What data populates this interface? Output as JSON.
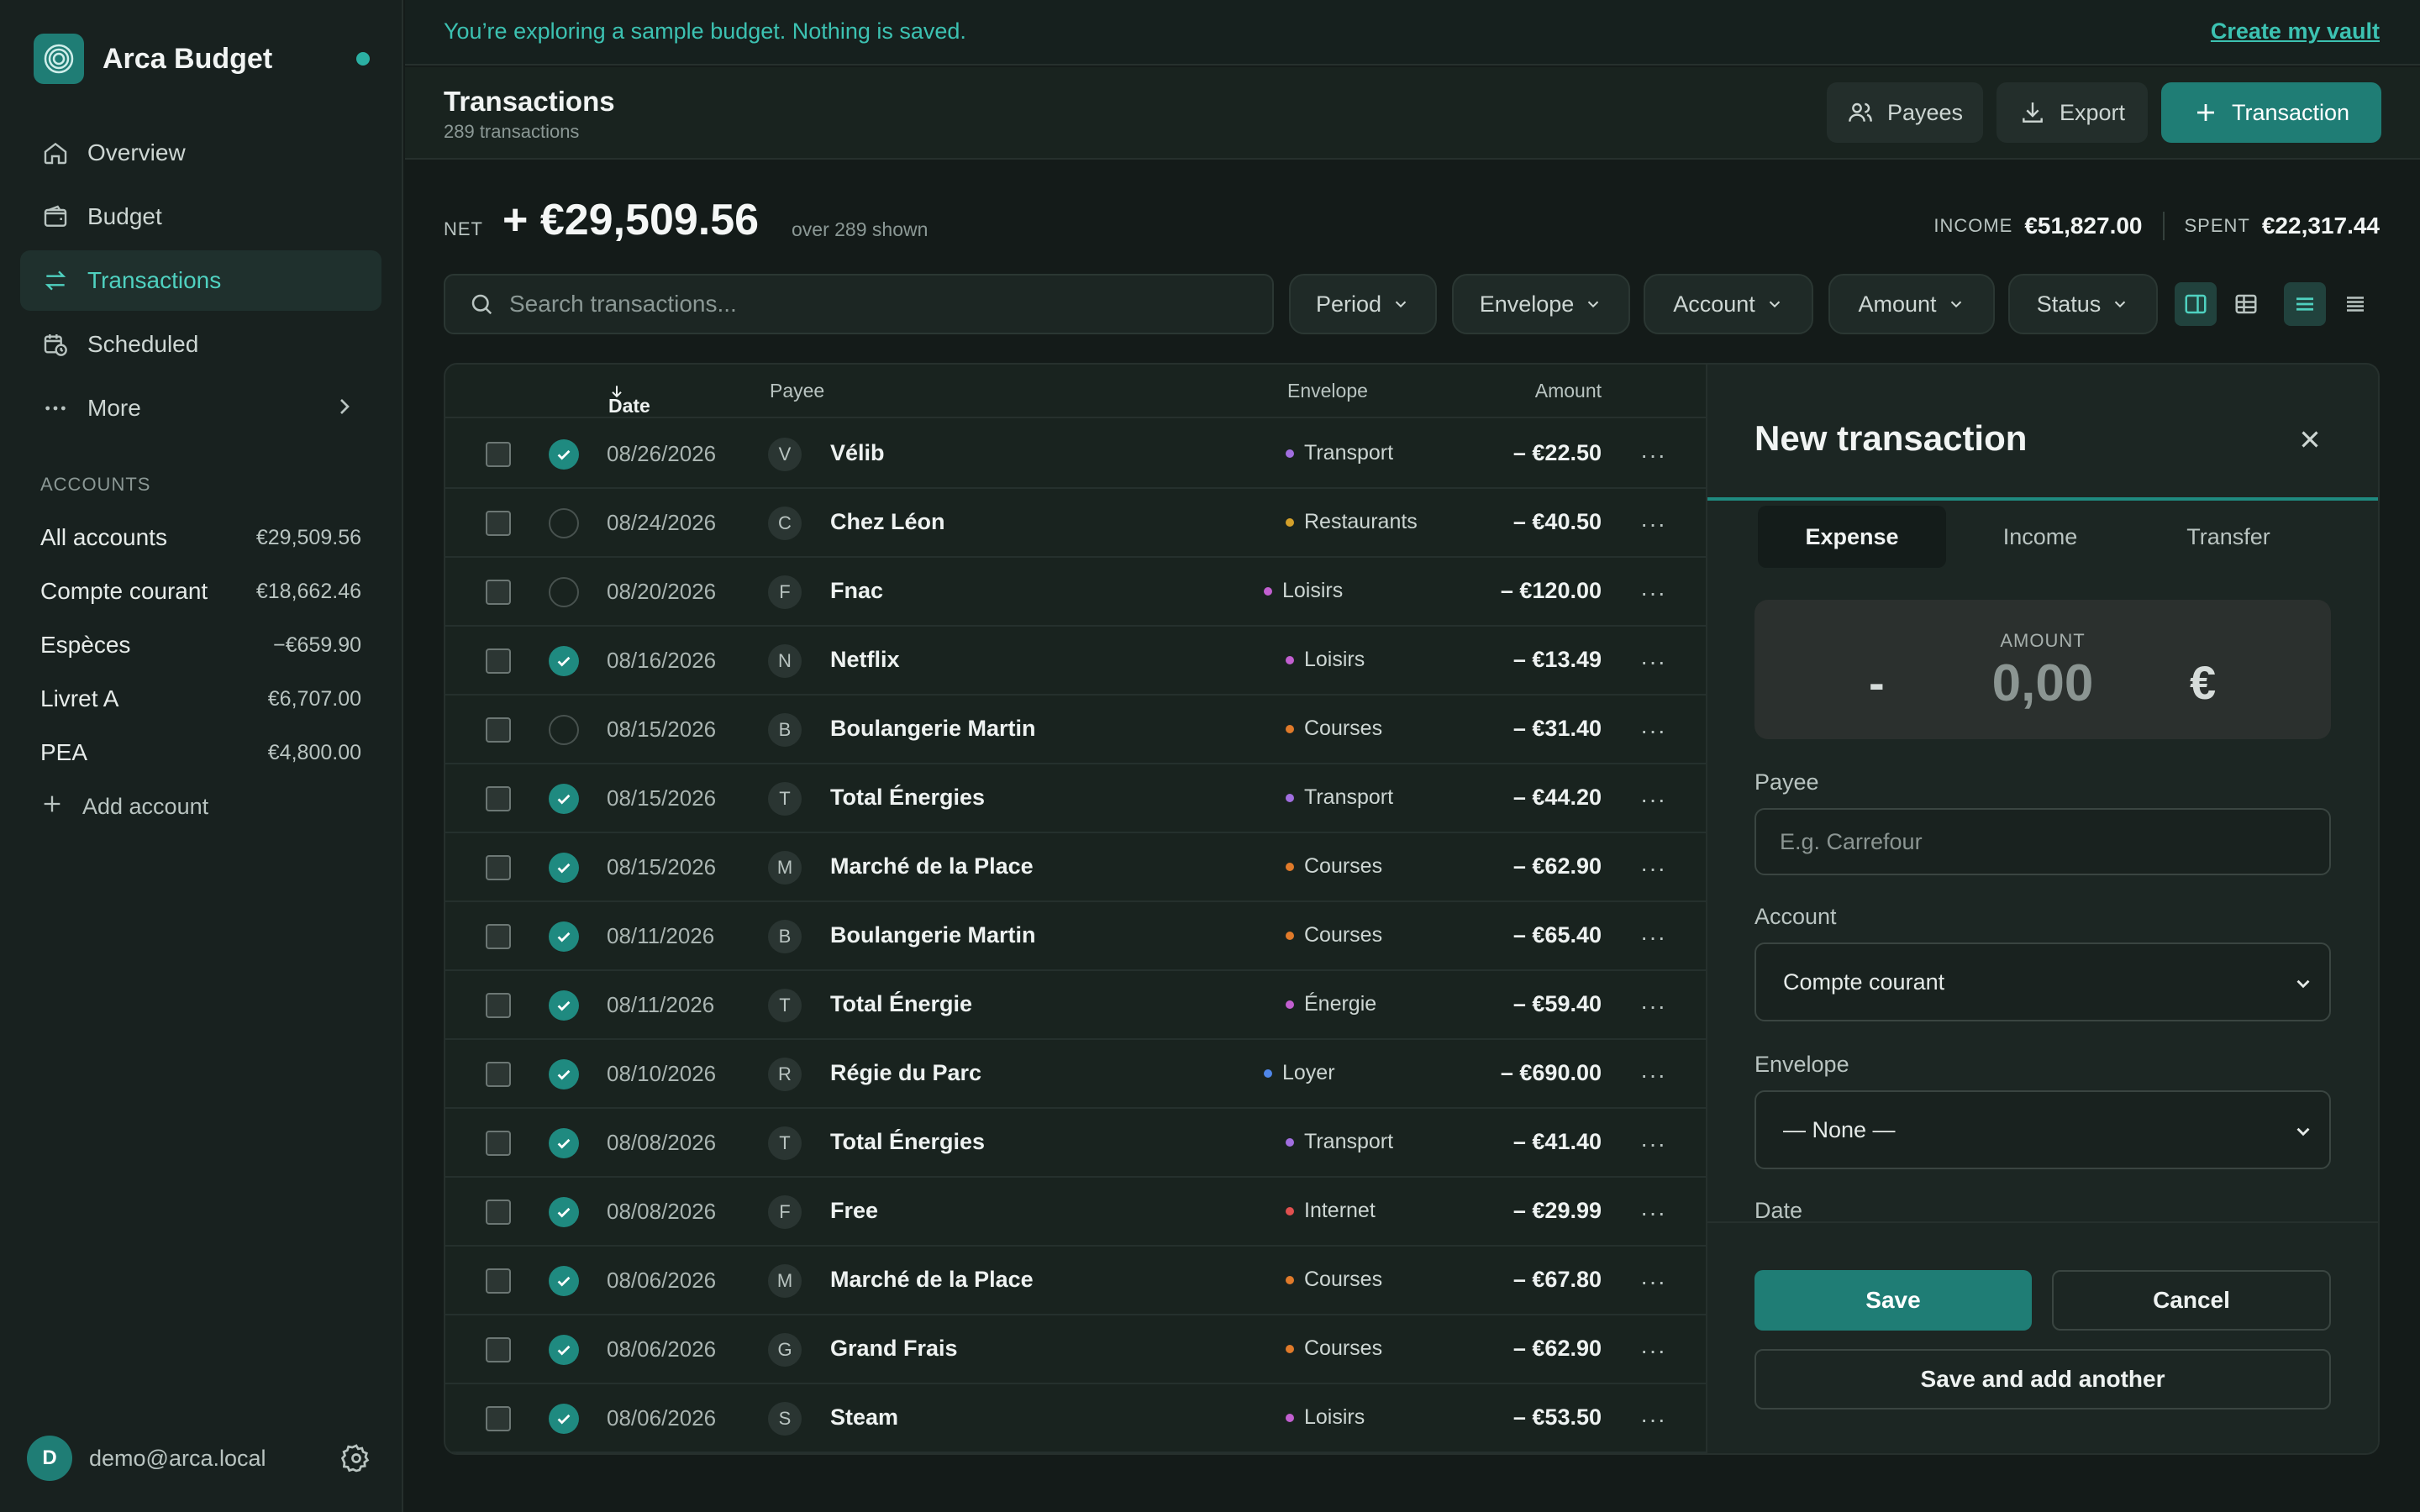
{
  "app": {
    "name": "Arca Budget"
  },
  "sidebar": {
    "nav": [
      {
        "label": "Overview",
        "icon": "home-icon"
      },
      {
        "label": "Budget",
        "icon": "wallet-icon"
      },
      {
        "label": "Transactions",
        "icon": "arrows-icon",
        "active": true
      },
      {
        "label": "Scheduled",
        "icon": "calendar-clock-icon"
      },
      {
        "label": "More",
        "icon": "dots-icon"
      }
    ],
    "accounts_label": "ACCOUNTS",
    "accounts": [
      {
        "name": "All accounts",
        "balance": "€29,509.56"
      },
      {
        "name": "Compte courant",
        "balance": "€18,662.46"
      },
      {
        "name": "Espèces",
        "balance": "−€659.90"
      },
      {
        "name": "Livret A",
        "balance": "€6,707.00"
      },
      {
        "name": "PEA",
        "balance": "€4,800.00"
      }
    ],
    "add_account": "Add account",
    "user": {
      "initial": "D",
      "email": "demo@arca.local"
    }
  },
  "banner": {
    "text": "You’re exploring a sample budget. Nothing is saved.",
    "link": "Create my vault"
  },
  "header": {
    "title": "Transactions",
    "subtitle": "289 transactions",
    "payees_btn": "Payees",
    "export_btn": "Export",
    "transaction_btn": "Transaction"
  },
  "summary": {
    "net_label": "NET",
    "net_value": "+ €29,509.56",
    "net_note": "over 289 shown",
    "income_label": "INCOME",
    "income_value": "€51,827.00",
    "spent_label": "SPENT",
    "spent_value": "€22,317.44"
  },
  "filters": {
    "search_placeholder": "Search transactions...",
    "buttons": [
      "Period",
      "Envelope",
      "Account",
      "Amount",
      "Status"
    ]
  },
  "table": {
    "columns": {
      "date": "Date",
      "payee": "Payee",
      "envelope": "Envelope",
      "amount": "Amount"
    },
    "rows": [
      {
        "cleared": true,
        "date": "08/26/2026",
        "initial": "V",
        "payee": "Vélib",
        "envelope": "Transport",
        "color": "#a16ee0",
        "amount": "– €22.50"
      },
      {
        "cleared": false,
        "date": "08/24/2026",
        "initial": "C",
        "payee": "Chez Léon",
        "envelope": "Restaurants",
        "color": "#d4a02a",
        "amount": "– €40.50"
      },
      {
        "cleared": false,
        "date": "08/20/2026",
        "initial": "F",
        "payee": "Fnac",
        "envelope": "Loisirs",
        "color": "#c25fd0",
        "amount": "– €120.00"
      },
      {
        "cleared": true,
        "date": "08/16/2026",
        "initial": "N",
        "payee": "Netflix",
        "envelope": "Loisirs",
        "color": "#c25fd0",
        "amount": "– €13.49"
      },
      {
        "cleared": false,
        "date": "08/15/2026",
        "initial": "B",
        "payee": "Boulangerie Martin",
        "envelope": "Courses",
        "color": "#e07a2a",
        "amount": "– €31.40"
      },
      {
        "cleared": true,
        "date": "08/15/2026",
        "initial": "T",
        "payee": "Total Énergies",
        "envelope": "Transport",
        "color": "#a16ee0",
        "amount": "– €44.20"
      },
      {
        "cleared": true,
        "date": "08/15/2026",
        "initial": "M",
        "payee": "Marché de la Place",
        "envelope": "Courses",
        "color": "#e07a2a",
        "amount": "– €62.90"
      },
      {
        "cleared": true,
        "date": "08/11/2026",
        "initial": "B",
        "payee": "Boulangerie Martin",
        "envelope": "Courses",
        "color": "#e07a2a",
        "amount": "– €65.40"
      },
      {
        "cleared": true,
        "date": "08/11/2026",
        "initial": "T",
        "payee": "Total Énergie",
        "envelope": "Énergie",
        "color": "#c25fd0",
        "amount": "– €59.40"
      },
      {
        "cleared": true,
        "date": "08/10/2026",
        "initial": "R",
        "payee": "Régie du Parc",
        "envelope": "Loyer",
        "color": "#4f86e8",
        "amount": "– €690.00"
      },
      {
        "cleared": true,
        "date": "08/08/2026",
        "initial": "T",
        "payee": "Total Énergies",
        "envelope": "Transport",
        "color": "#a16ee0",
        "amount": "– €41.40"
      },
      {
        "cleared": true,
        "date": "08/08/2026",
        "initial": "F",
        "payee": "Free",
        "envelope": "Internet",
        "color": "#e0504f",
        "amount": "– €29.99"
      },
      {
        "cleared": true,
        "date": "08/06/2026",
        "initial": "M",
        "payee": "Marché de la Place",
        "envelope": "Courses",
        "color": "#e07a2a",
        "amount": "– €67.80"
      },
      {
        "cleared": true,
        "date": "08/06/2026",
        "initial": "G",
        "payee": "Grand Frais",
        "envelope": "Courses",
        "color": "#e07a2a",
        "amount": "– €62.90"
      },
      {
        "cleared": true,
        "date": "08/06/2026",
        "initial": "S",
        "payee": "Steam",
        "envelope": "Loisirs",
        "color": "#c25fd0",
        "amount": "– €53.50"
      }
    ]
  },
  "panel": {
    "title": "New transaction",
    "tabs": [
      "Expense",
      "Income",
      "Transfer"
    ],
    "amount_label": "AMOUNT",
    "amount_sign": "-",
    "amount_value": "0,00",
    "currency": "€",
    "payee_label": "Payee",
    "payee_placeholder": "E.g. Carrefour",
    "account_label": "Account",
    "account_value": "Compte courant",
    "envelope_label": "Envelope",
    "envelope_value": "— None —",
    "date_label": "Date",
    "save": "Save",
    "cancel": "Cancel",
    "save_another": "Save and add another"
  },
  "colors": {
    "accent": "#1f7d75",
    "accent_text": "#3cc2b2",
    "background": "#141b19"
  }
}
